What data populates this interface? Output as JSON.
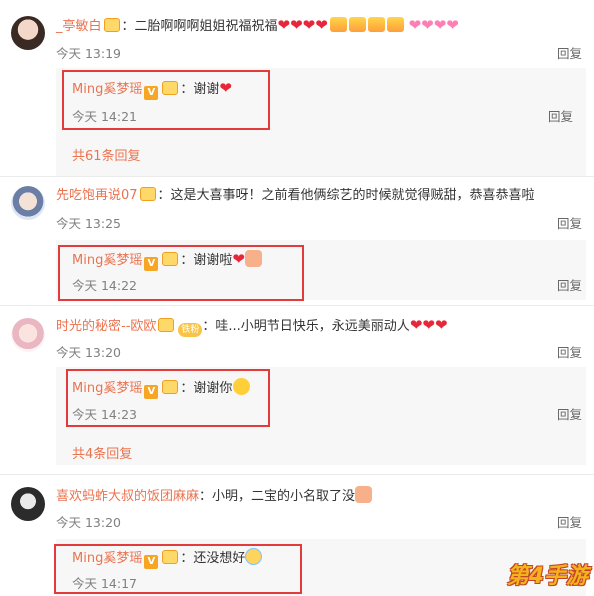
{
  "comments": [
    {
      "user": "_亭敏白",
      "text": "：二胎啊啊啊姐姐祝福祝福",
      "time": "今天 13:19",
      "reply_label": "回复",
      "reply": {
        "user": "Ming奚梦瑶",
        "text": "：谢谢",
        "time": "今天 14:21",
        "reply_label": "回复"
      },
      "more": "共61条回复"
    },
    {
      "user": "先吃饱再说07",
      "text": "：这是大喜事呀！之前看他俩综艺的时候就觉得贼甜，恭喜恭喜啦",
      "time": "今天 13:25",
      "reply_label": "回复",
      "reply": {
        "user": "Ming奚梦瑶",
        "text": "：谢谢啦",
        "time": "今天 14:22",
        "reply_label": "回复"
      }
    },
    {
      "user": "时光的秘密--欧欧",
      "fan_badge": "铁粉",
      "text": "：哇...小明节日快乐，永远美丽动人",
      "time": "今天 13:20",
      "reply_label": "回复",
      "reply": {
        "user": "Ming奚梦瑶",
        "text": "：谢谢你",
        "time": "今天 14:23",
        "reply_label": "回复"
      },
      "more": "共4条回复"
    },
    {
      "user": "喜欢蚂蚱大叔的饭团麻麻",
      "text": "：小明，二宝的小名取了没",
      "time": "今天 13:20",
      "reply_label": "回复",
      "reply": {
        "user": "Ming奚梦瑶",
        "text": "：还没想好",
        "time": "今天 14:17"
      }
    }
  ],
  "verified_badge": "V",
  "watermark": "第4手游",
  "colors": {
    "username": "#eb7350",
    "highlight_frame": "#e23b3b",
    "reply_bg": "#f7f7f7"
  }
}
